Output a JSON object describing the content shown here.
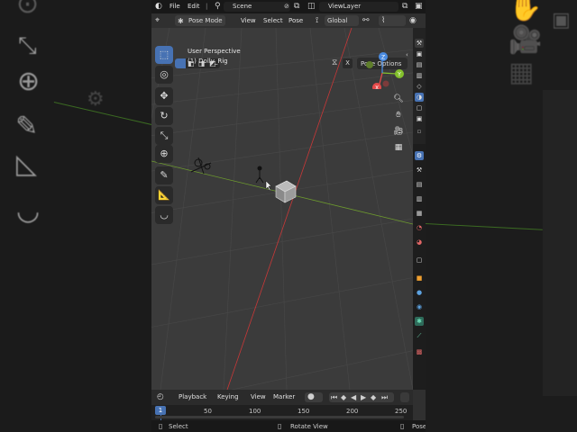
{
  "colors": {
    "accent": "#4772b3",
    "x_axis": "#d33b3b",
    "y_axis_line": "#7ea33a",
    "gizmo_x": "#e64b4b",
    "gizmo_y": "#84c12d",
    "gizmo_z": "#4a8be0"
  },
  "topbar": {
    "menu_file": "File",
    "menu_edit": "Edit",
    "scene_name": "Scene",
    "view_layer": "ViewLayer"
  },
  "header": {
    "mode": "Pose Mode",
    "menu_view": "View",
    "menu_select": "Select",
    "menu_pose": "Pose",
    "orientation": "Global",
    "pose_options": "Pose Options",
    "x_toggle": "X"
  },
  "viewport": {
    "view_name": "User Perspective",
    "object_name": "(1) Dolly_Rig"
  },
  "gizmo": {
    "x": "X",
    "y": "Y",
    "z": "Z"
  },
  "tools": [
    {
      "name": "select-box-icon",
      "glyph": "⬚"
    },
    {
      "name": "cursor-icon",
      "glyph": "◎"
    },
    {
      "name": "move-icon",
      "glyph": "✥"
    },
    {
      "name": "rotate-icon",
      "glyph": "↻"
    },
    {
      "name": "scale-icon",
      "glyph": "⤡"
    },
    {
      "name": "transform-icon",
      "glyph": "⊕"
    },
    {
      "name": "annotate-icon",
      "glyph": "✎"
    },
    {
      "name": "measure-icon",
      "glyph": "📐"
    },
    {
      "name": "pose-relax-icon",
      "glyph": "◡"
    }
  ],
  "timeline": {
    "menu_playback": "Playback",
    "menu_keying": "Keying",
    "menu_view": "View",
    "menu_marker": "Marker",
    "current_frame": "1",
    "ticks": [
      "50",
      "100",
      "150",
      "200",
      "250"
    ]
  },
  "status": {
    "select": "Select",
    "rotate_view": "Rotate View",
    "pose": "Pose"
  }
}
